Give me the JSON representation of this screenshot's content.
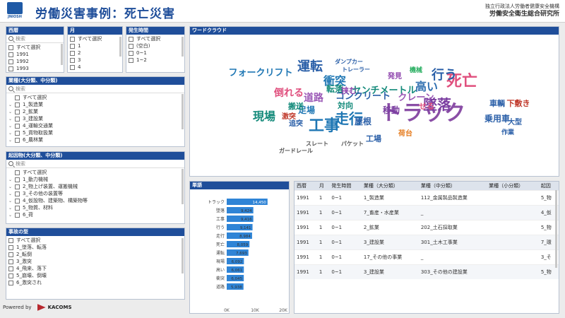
{
  "header": {
    "logo_text": "JNIOSH",
    "title": "労働災害事例：死亡災害",
    "org_line1": "独立行政法人労働者健康安全機構",
    "org_line2": "労働安全衛生総合研究所"
  },
  "filters": {
    "year": {
      "title": "西暦",
      "placeholder": "検索",
      "items": [
        "すべて選択",
        "1991",
        "1992",
        "1993"
      ]
    },
    "month": {
      "title": "月",
      "items": [
        "すべて選択",
        "1",
        "2",
        "3",
        "4"
      ]
    },
    "time": {
      "title": "発生時間",
      "items": [
        "すべて選択",
        "(空白)",
        "0~1",
        "1~2"
      ]
    },
    "industry": {
      "title": "業種(大分類、中分類)",
      "placeholder": "検索",
      "items": [
        "すべて選択",
        "1_製造業",
        "2_鉱業",
        "3_建設業",
        "4_運輸交通業",
        "5_貨物取扱業",
        "6_農林業"
      ]
    },
    "cause": {
      "title": "起因物(大分類、中分類)",
      "placeholder": "検索",
      "items": [
        "すべて選択",
        "1_動力機械",
        "2_物上げ装置、運搬機械",
        "3_その他の装置等",
        "4_仮設物、建築物、構築物等",
        "5_物質、材料",
        "6_荷"
      ]
    },
    "accident": {
      "title": "事故の型",
      "items": [
        "すべて選択",
        "1_墜落、転落",
        "2_転倒",
        "3_激突",
        "4_飛来、落下",
        "5_崩壊、倒壊",
        "6_激突され"
      ]
    }
  },
  "wordcloud": {
    "title": "ワードクラウド",
    "words": [
      {
        "t": "トラック",
        "c": "#8a4ea6"
      },
      {
        "t": "死亡",
        "c": "#e0507e"
      },
      {
        "t": "工事",
        "c": "#1f77b4"
      },
      {
        "t": "墜落",
        "c": "#7b3ea1"
      },
      {
        "t": "走行",
        "c": "#1f77b4"
      },
      {
        "t": "運転",
        "c": "#2a5fa8"
      },
      {
        "t": "行う",
        "c": "#2a5fa8"
      },
      {
        "t": "高い",
        "c": "#2f6fb0"
      },
      {
        "t": "現場",
        "c": "#138a7a"
      },
      {
        "t": "衝突",
        "c": "#1f77b4"
      },
      {
        "t": "倒れる",
        "c": "#e0507e"
      },
      {
        "t": "道路",
        "c": "#9b59b6"
      },
      {
        "t": "フォークリフト",
        "c": "#1f77b4"
      },
      {
        "t": "センチメートル",
        "c": "#138a7a"
      },
      {
        "t": "コンクリート",
        "c": "#2a5fa8"
      },
      {
        "t": "クレーン",
        "c": "#9b59b6"
      },
      {
        "t": "転落",
        "c": "#138a7a"
      },
      {
        "t": "移動",
        "c": "#7b3ea1"
      },
      {
        "t": "屋根",
        "c": "#2a5fa8"
      },
      {
        "t": "足場",
        "c": "#1f77b4"
      },
      {
        "t": "乗用車",
        "c": "#2a5fa8"
      },
      {
        "t": "挟む",
        "c": "#8e44ad"
      },
      {
        "t": "車輌",
        "c": "#2a5fa8"
      },
      {
        "t": "工場",
        "c": "#2a5fa8"
      },
      {
        "t": "対向",
        "c": "#138a7a"
      },
      {
        "t": "搬送",
        "c": "#138a7a"
      },
      {
        "t": "せる",
        "c": "#e0507e"
      },
      {
        "t": "激突",
        "c": "#c0392b"
      },
      {
        "t": "大型",
        "c": "#2a5fa8"
      },
      {
        "t": "追突",
        "c": "#2a5fa8"
      },
      {
        "t": "作業",
        "c": "#2a5fa8"
      },
      {
        "t": "機械",
        "c": "#27ae60"
      },
      {
        "t": "発見",
        "c": "#8e44ad"
      },
      {
        "t": "荷台",
        "c": "#e67e22"
      },
      {
        "t": "下敷き",
        "c": "#c0392b"
      },
      {
        "t": "ダンプカー",
        "c": "#2a5fa8"
      },
      {
        "t": "スレート",
        "c": "#555"
      },
      {
        "t": "ガードレール",
        "c": "#555"
      },
      {
        "t": "パケット",
        "c": "#555"
      },
      {
        "t": "トレーラー",
        "c": "#2a5fa8"
      }
    ]
  },
  "bar": {
    "title": "単語"
  },
  "chart_data": {
    "type": "bar",
    "orientation": "horizontal",
    "categories": [
      "トラック",
      "墜落",
      "工事",
      "行う",
      "走行",
      "死亡",
      "運転",
      "現場",
      "高い",
      "衝突",
      "道路"
    ],
    "values": [
      14450,
      9424,
      9416,
      9141,
      8984,
      8059,
      7693,
      6092,
      6061,
      6045,
      5938
    ],
    "value_labels": [
      "14,450",
      "9,424",
      "9,416",
      "9,141",
      "8,984",
      "8,059",
      "7,693",
      "6,092",
      "6,061",
      "6,045",
      "5,938"
    ],
    "xlim": [
      0,
      20000
    ],
    "ticks": [
      "0K",
      "10K",
      "20K"
    ],
    "color": "#2f84d6"
  },
  "table": {
    "columns": [
      "西暦",
      "月",
      "発生時間",
      "業種（大分類）",
      "業種（中分類）",
      "業種（小分類）",
      "起因"
    ],
    "rows": [
      [
        "1991",
        "1",
        "0~1",
        "1_製造業",
        "112_金属製品製造業",
        "",
        "5_物"
      ],
      [
        "1991",
        "1",
        "0~1",
        "7_畜産・水産業",
        "_",
        "",
        "4_仮"
      ],
      [
        "1991",
        "1",
        "0~1",
        "2_鉱業",
        "202_土石採取業",
        "",
        "5_物"
      ],
      [
        "1991",
        "1",
        "0~1",
        "3_建設業",
        "301_土木工事業",
        "",
        "7_環"
      ],
      [
        "1991",
        "1",
        "0~1",
        "17_その他の事業",
        "_",
        "",
        "3_そ"
      ],
      [
        "1991",
        "1",
        "0~1",
        "3_建設業",
        "303_その他の建設業",
        "",
        "5_物"
      ]
    ]
  },
  "footer": {
    "powered": "Powered by",
    "company": "KACOMS"
  }
}
